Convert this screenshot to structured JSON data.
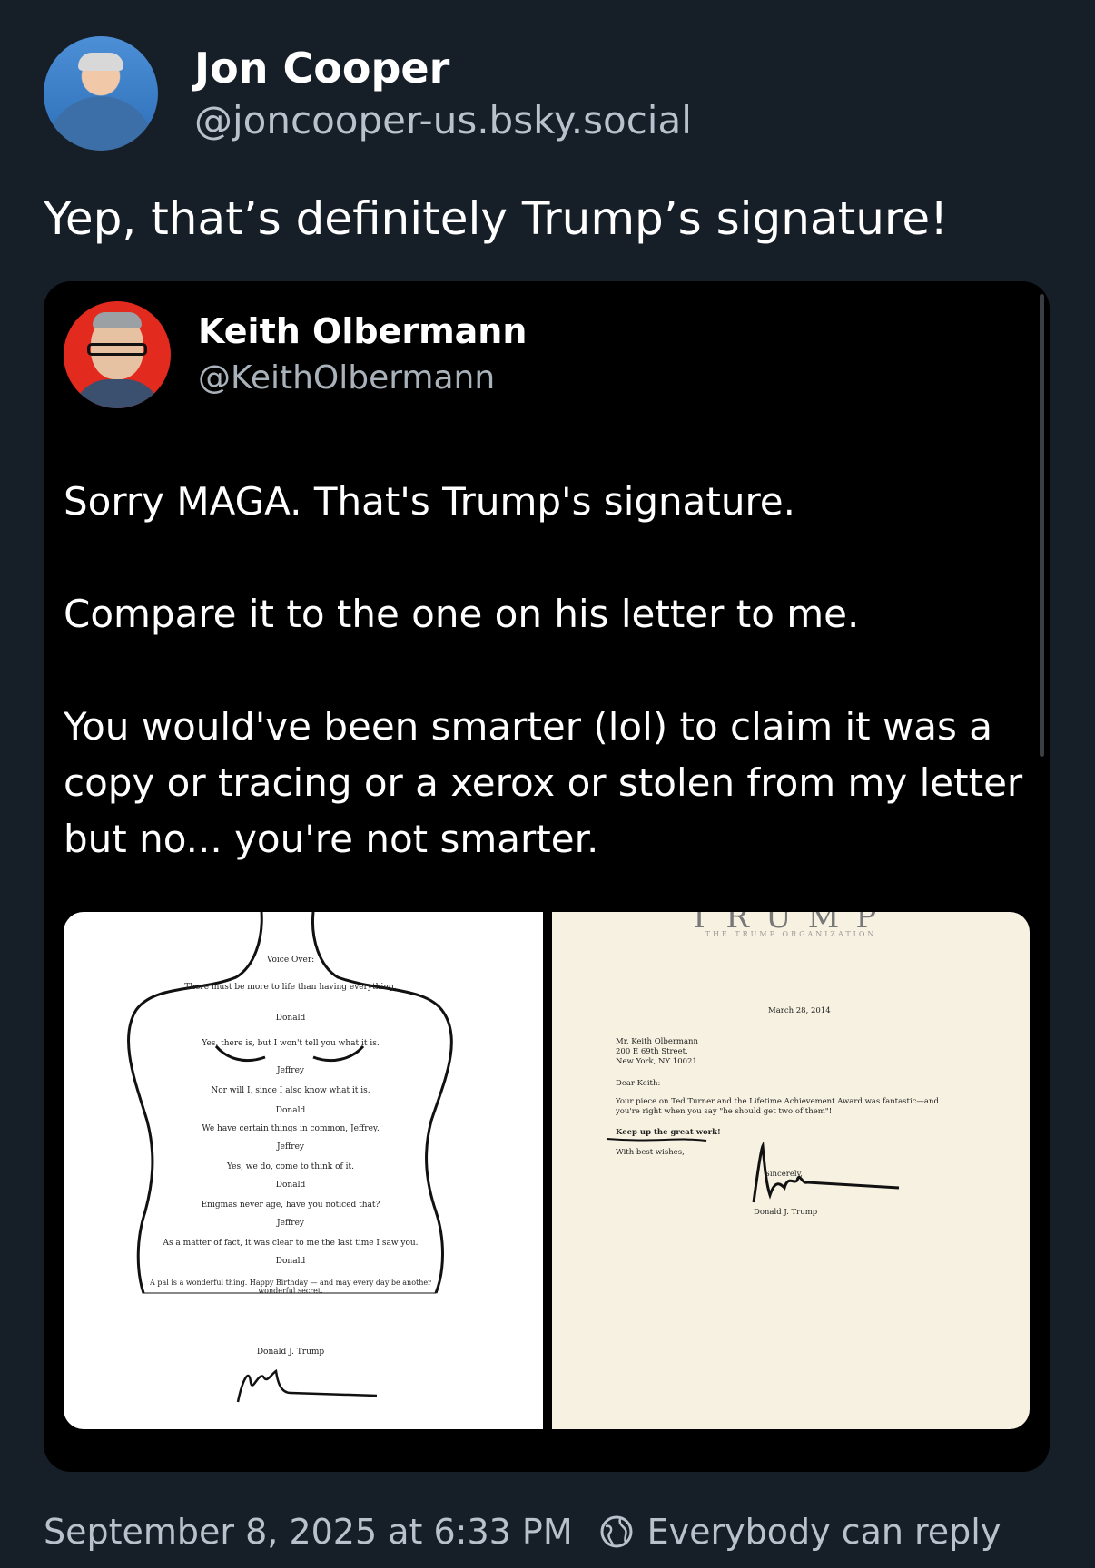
{
  "author": {
    "name": "Jon Cooper",
    "handle": "@joncooper-us.bsky.social"
  },
  "post_text": "Yep, that’s definitely Trump’s signature!",
  "quoted_post": {
    "author": {
      "name": "Keith Olbermann",
      "handle": "@KeithOlbermann"
    },
    "paragraphs": [
      "Sorry MAGA. That's Trump's signature.",
      "Compare it to the one on his letter to me.",
      "You would've been smarter (lol) to claim it was a copy or tracing or a xerox or stolen from my letter but no... you're not smarter."
    ],
    "images": {
      "left_poem": {
        "lines": [
          "Voice Over:",
          "There must be more to life than having everything.",
          "Donald",
          "Yes, there is, but I won't tell you what it is.",
          "Jeffrey",
          "Nor will I, since I also know what it is.",
          "Donald",
          "We have certain things in common, Jeffrey.",
          "Jeffrey",
          "Yes, we do, come to think of it.",
          "Donald",
          "Enigmas never age, have you noticed that?",
          "Jeffrey",
          "As a matter of fact, it was clear to me the last time I saw you.",
          "Donald",
          "A pal is a wonderful thing. Happy Birthday — and may every day be another wonderful secret.",
          "Donald J. Trump"
        ]
      },
      "right_letter": {
        "brand": "TRUMP",
        "org": "THE TRUMP ORGANIZATION",
        "date": "March 28, 2014",
        "address": [
          "Mr. Keith Olbermann",
          "200 E 69th Street,",
          "New York, NY 10021"
        ],
        "salutation": "Dear Keith:",
        "body": [
          "Your piece on Ted Turner and the Lifetime Achievement Award was fantastic—and",
          "you're right when you say \"he should get two of them\"!"
        ],
        "note": "Keep up the great work!",
        "closing": "With best wishes,",
        "sincerely": "Sincerely,",
        "signer": "Donald J. Trump"
      }
    }
  },
  "footer": {
    "timestamp": "September 8, 2025 at 6:33 PM",
    "reply_setting": "Everybody can reply",
    "icon": "globe-icon"
  }
}
